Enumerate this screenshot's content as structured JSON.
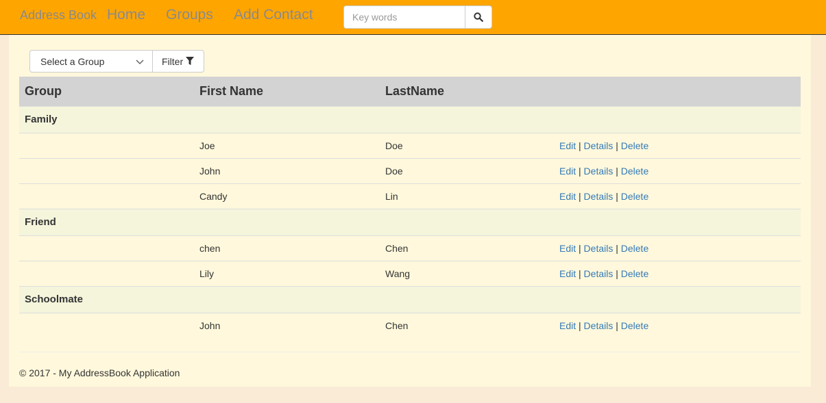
{
  "nav": {
    "brand": "Address Book",
    "links": [
      "Home",
      "Groups",
      "Add Contact"
    ],
    "search_placeholder": "Key words"
  },
  "toolbar": {
    "select_label": "Select a Group",
    "filter_label": "Filter"
  },
  "table": {
    "headers": [
      "Group",
      "First Name",
      "LastName"
    ],
    "actions": [
      "Edit",
      "Details",
      "Delete"
    ],
    "groups": [
      {
        "name": "Family",
        "rows": [
          {
            "first": "Joe",
            "last": "Doe"
          },
          {
            "first": "John",
            "last": "Doe"
          },
          {
            "first": "Candy",
            "last": "Lin"
          }
        ]
      },
      {
        "name": "Friend",
        "rows": [
          {
            "first": "chen",
            "last": "Chen"
          },
          {
            "first": "Lily",
            "last": "Wang"
          }
        ]
      },
      {
        "name": "Schoolmate",
        "rows": [
          {
            "first": "John",
            "last": "Chen"
          }
        ]
      }
    ]
  },
  "footer": {
    "text": "© 2017 - My AddressBook Application"
  }
}
